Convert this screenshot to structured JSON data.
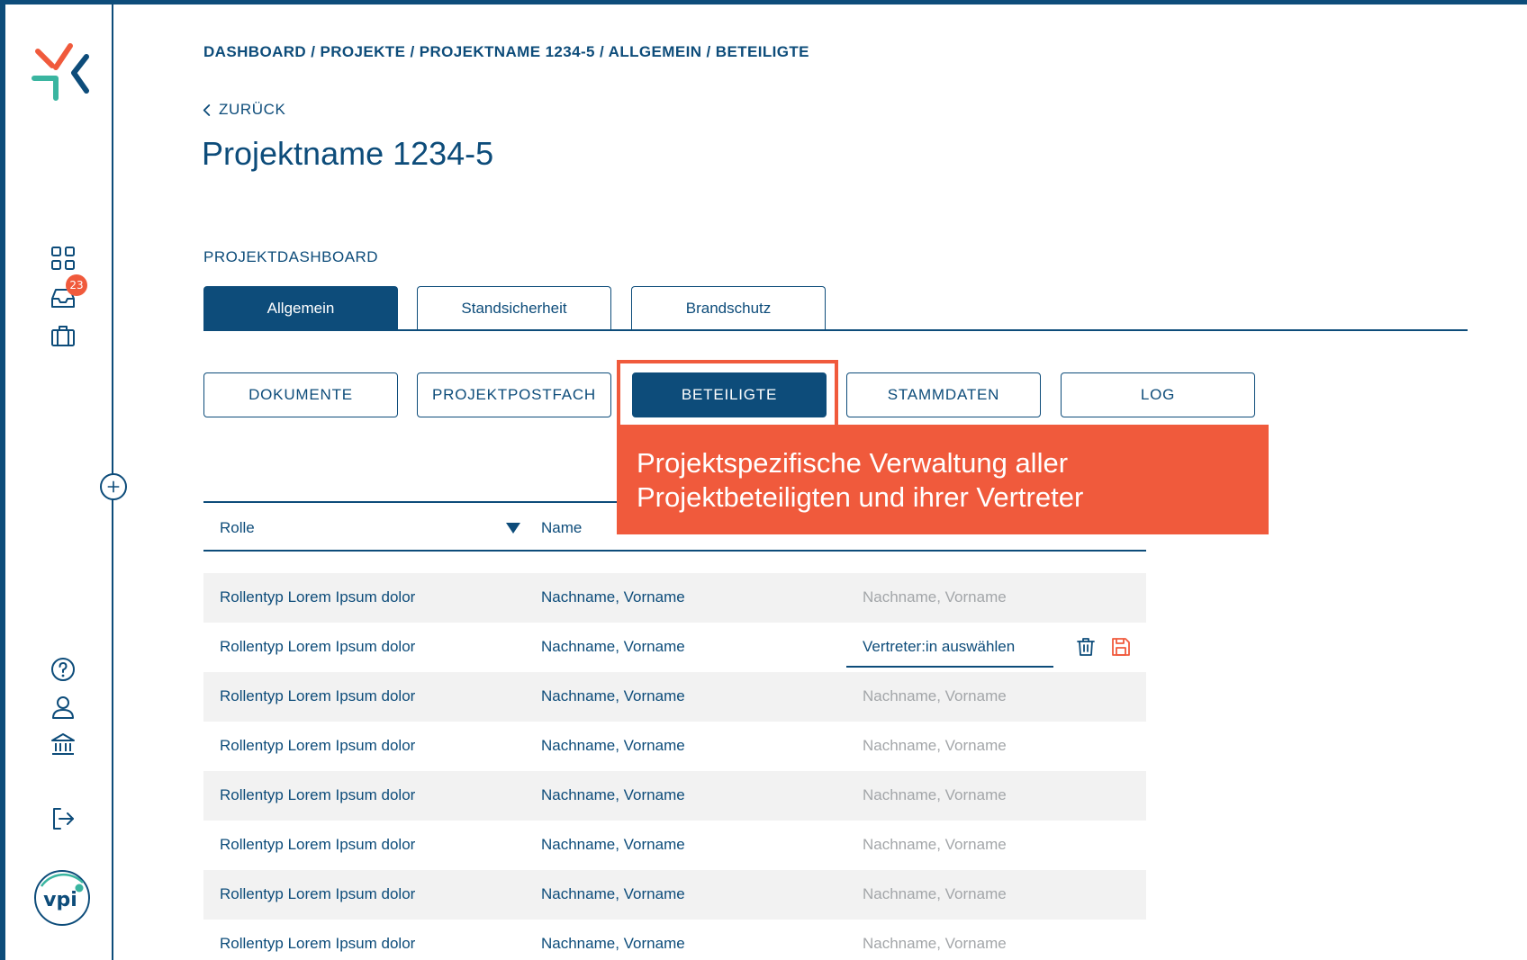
{
  "breadcrumb": {
    "items": [
      "DASHBOARD",
      "PROJEKTE",
      "PROJEKTNAME 1234-5",
      "ALLGEMEIN",
      "BETEILIGTE"
    ],
    "separator": " / "
  },
  "back_label": "ZURÜCK",
  "page_title": "Projektname 1234-5",
  "section_label": "PROJEKTDASHBOARD",
  "sidebar": {
    "badge_count": "23",
    "icons": [
      "dashboard-grid-icon",
      "inbox-icon",
      "briefcase-icon",
      "help-icon",
      "user-icon",
      "institution-icon",
      "logout-icon"
    ]
  },
  "tabs": [
    {
      "label": "Allgemein",
      "active": true
    },
    {
      "label": "Standsicherheit",
      "active": false
    },
    {
      "label": "Brandschutz",
      "active": false
    }
  ],
  "subnav": [
    {
      "label": "DOKUMENTE",
      "active": false
    },
    {
      "label": "PROJEKTPOSTFACH",
      "active": false
    },
    {
      "label": "BETEILIGTE",
      "active": true
    },
    {
      "label": "STAMMDATEN",
      "active": false
    },
    {
      "label": "LOG",
      "active": false
    }
  ],
  "callout": {
    "line1": "Projektspezifische Verwaltung aller",
    "line2": "Projektbeteiligten und ihrer Vertreter"
  },
  "table": {
    "headers": {
      "role": "Rolle",
      "name": "Name"
    },
    "rows": [
      {
        "role": "Rollentyp Lorem Ipsum dolor",
        "name": "Nachname, Vorname",
        "vertreter": "Nachname, Vorname"
      },
      {
        "role": "Rollentyp Lorem Ipsum dolor",
        "name": "Nachname, Vorname",
        "vertreter": "Vertreter:in auswählen",
        "editing": true
      },
      {
        "role": "Rollentyp Lorem Ipsum dolor",
        "name": "Nachname, Vorname",
        "vertreter": "Nachname, Vorname"
      },
      {
        "role": "Rollentyp Lorem Ipsum dolor",
        "name": "Nachname, Vorname",
        "vertreter": "Nachname, Vorname"
      },
      {
        "role": "Rollentyp Lorem Ipsum dolor",
        "name": "Nachname, Vorname",
        "vertreter": "Nachname, Vorname"
      },
      {
        "role": "Rollentyp Lorem Ipsum dolor",
        "name": "Nachname, Vorname",
        "vertreter": "Nachname, Vorname"
      },
      {
        "role": "Rollentyp Lorem Ipsum dolor",
        "name": "Nachname, Vorname",
        "vertreter": "Nachname, Vorname"
      },
      {
        "role": "Rollentyp Lorem Ipsum dolor",
        "name": "Nachname, Vorname",
        "vertreter": "Nachname, Vorname"
      }
    ]
  },
  "colors": {
    "primary": "#0d4c7a",
    "accent": "#f05a3c",
    "teal": "#3ab5a0",
    "row_shade": "#f2f2f2",
    "muted_text": "#a3a6a9"
  },
  "vpi_logo_text": "vpi"
}
